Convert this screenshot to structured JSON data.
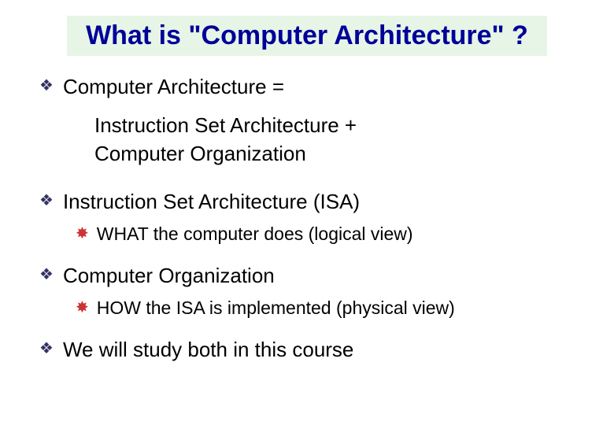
{
  "title": "What is \"Computer Architecture\" ?",
  "bullets": [
    {
      "text": "Computer Architecture   ="
    },
    {
      "text": "Instruction Set Architecture (ISA)"
    },
    {
      "text": "Computer Organization"
    },
    {
      "text": "We will study both in this course"
    }
  ],
  "indent": {
    "line1": "Instruction Set Architecture +",
    "line2": "Computer Organization"
  },
  "subs": [
    {
      "text": "WHAT the computer does (logical view)"
    },
    {
      "text": "HOW the ISA is implemented (physical view)"
    }
  ],
  "icons": {
    "diamond": "❖",
    "star": "✸"
  }
}
